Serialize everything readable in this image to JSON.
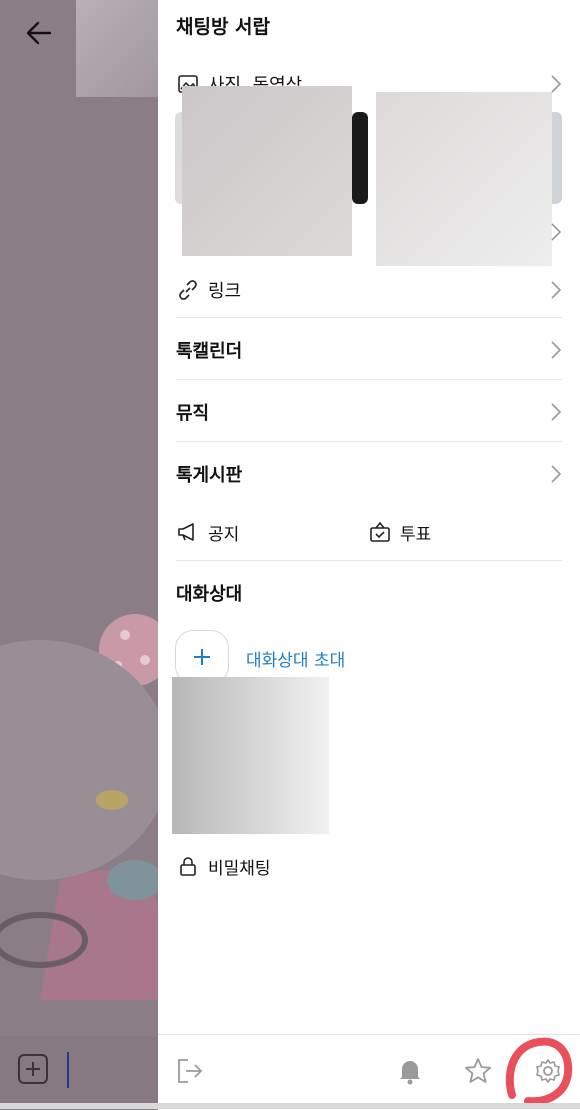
{
  "drawer": {
    "title": "채팅방 서랍",
    "media_label": "사진, 동영상",
    "link_label": "링크",
    "calendar_label": "톡캘린더",
    "music_label": "뮤직",
    "board_label": "톡게시판",
    "notice_label": "공지",
    "vote_label": "투표",
    "participants_title": "대화상대",
    "invite_label": "대화상대 초대",
    "secret_chat_label": "비밀채팅"
  },
  "colors": {
    "accent_blue": "#1e7fc7",
    "highlight_red": "#e8505b"
  },
  "icons": {
    "back": "arrow-left-icon",
    "media": "image-icon",
    "link": "link-icon",
    "notice": "megaphone-icon",
    "vote": "ballot-box-icon",
    "lock": "lock-icon",
    "exit": "exit-icon",
    "bell": "bell-icon",
    "star": "star-icon",
    "settings": "gear-icon"
  }
}
